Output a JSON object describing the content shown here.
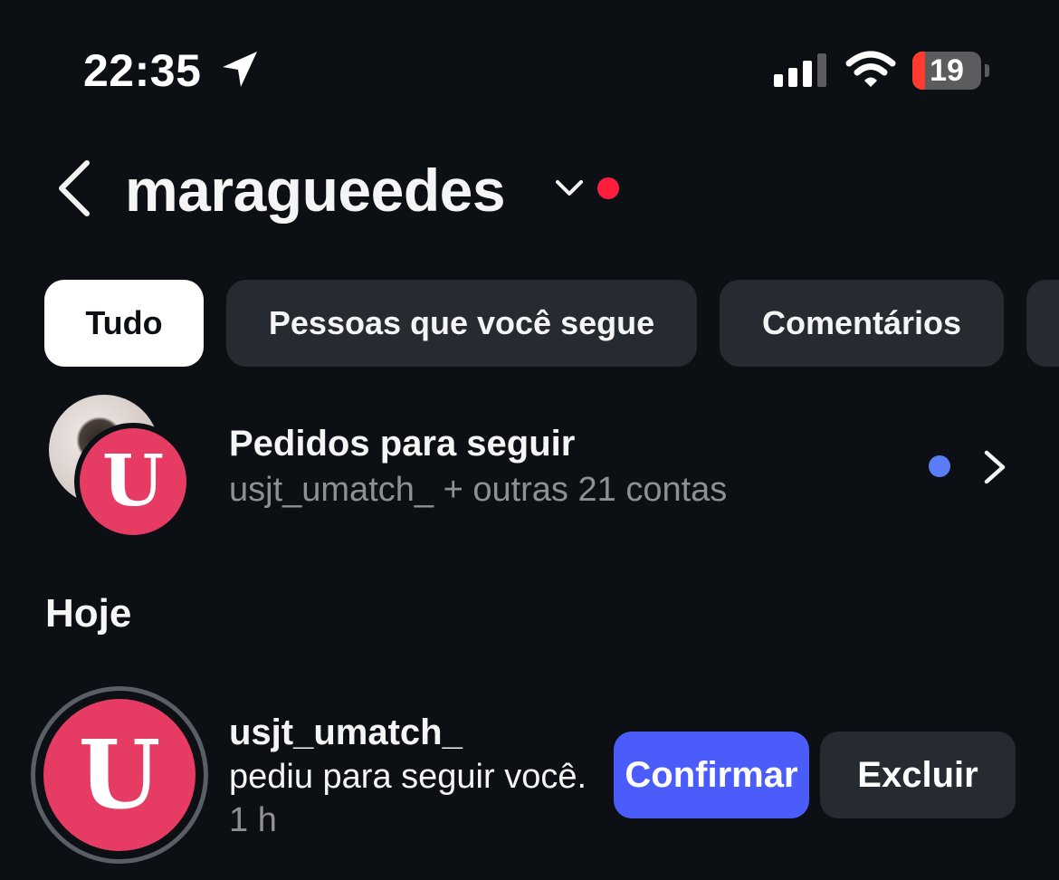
{
  "status_bar": {
    "time": "22:35",
    "battery_level": "19",
    "battery_fraction": 0.19,
    "icons": [
      "location-arrow-icon",
      "cellular-signal-icon",
      "wifi-icon",
      "battery-icon"
    ]
  },
  "header": {
    "username": "maragueedes",
    "icons": [
      "back-chevron-icon",
      "account-switch-caret-icon"
    ]
  },
  "filters": [
    {
      "label": "Tudo",
      "active": true
    },
    {
      "label": "Pessoas que você segue",
      "active": false
    },
    {
      "label": "Comentários",
      "active": false
    }
  ],
  "follow_requests": {
    "title": "Pedidos para seguir",
    "subtitle": "usjt_umatch_ + outras 21 contas",
    "avatar_letter": "U"
  },
  "section_today": "Hoje",
  "notification": {
    "username": "usjt_umatch_",
    "text": "pediu para seguir você.",
    "time": "1 h",
    "avatar_letter": "U",
    "confirm_label": "Confirmar",
    "delete_label": "Excluir"
  },
  "colors": {
    "background": "#0c0f14",
    "unread_dot_red": "#ff1f3d",
    "unread_dot_blue": "#5b7cf7",
    "confirm_button": "#4a5dfb",
    "avatar_pink": "#e63b62"
  }
}
